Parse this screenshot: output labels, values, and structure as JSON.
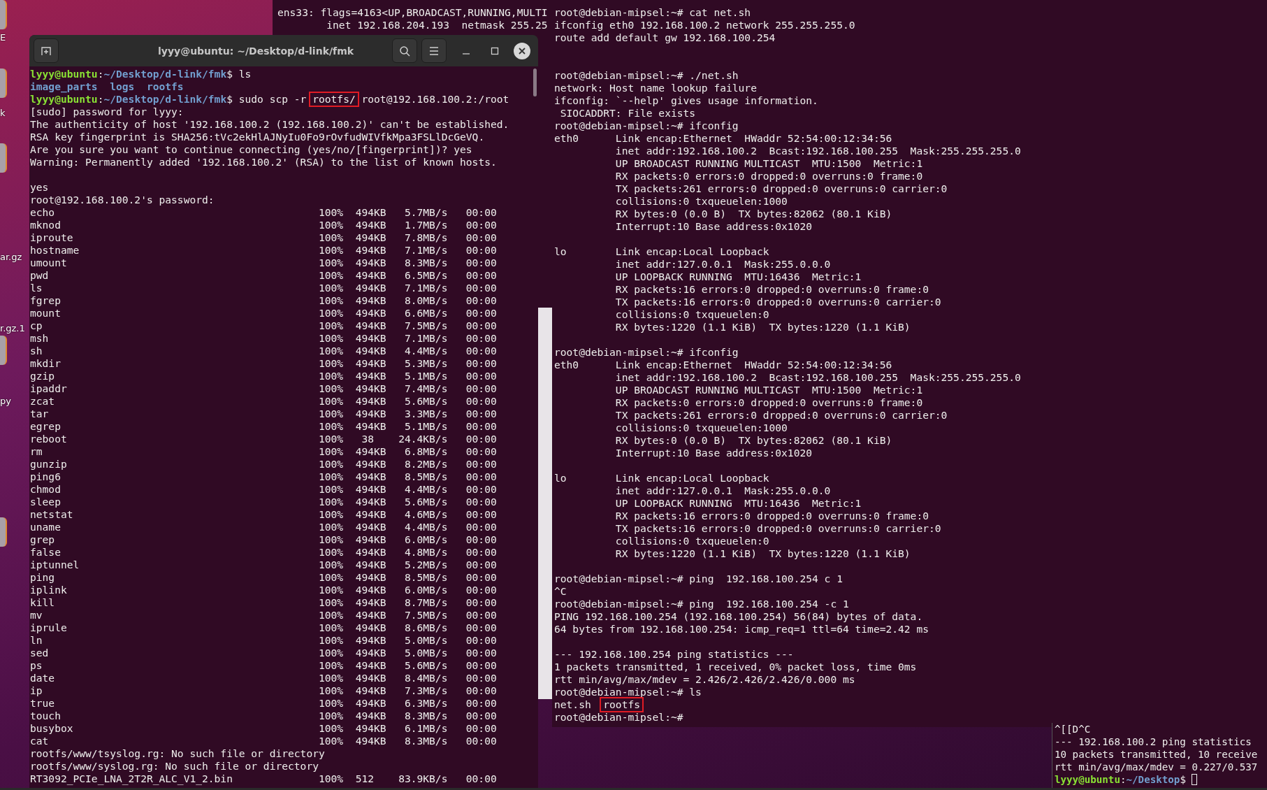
{
  "desktop_icons": [
    {
      "label": "E"
    },
    {
      "label": "k"
    },
    {
      "label": "ar.gz"
    },
    {
      "label": "r.gz.1"
    },
    {
      "label": "py"
    }
  ],
  "terminals": [
    {
      "kind": "back",
      "lines": [
        {
          "kind": "text",
          "text": "ens33: flags=4163<UP,BROADCAST,RUNNING,MULTI"
        },
        {
          "kind": "text",
          "text": "        inet 192.168.204.193  netmask 255.25"
        }
      ]
    },
    {
      "kind": "main",
      "title": "lyyy@ubuntu: ~/Desktop/d-link/fmk",
      "lines": [
        {
          "kind": "segments",
          "segments": [
            {
              "kind": "user",
              "text": "lyyy@ubuntu"
            },
            {
              "kind": "plain",
              "text": ":"
            },
            {
              "kind": "path",
              "text": "~/Desktop/d-link/fmk"
            },
            {
              "kind": "plain",
              "text": "$ ls"
            }
          ]
        },
        {
          "kind": "segments",
          "segments": [
            {
              "kind": "dir",
              "text": "image_parts  logs  rootfs"
            }
          ]
        },
        {
          "kind": "segments",
          "segments": [
            {
              "kind": "user",
              "text": "lyyy@ubuntu"
            },
            {
              "kind": "plain",
              "text": ":"
            },
            {
              "kind": "path",
              "text": "~/Desktop/d-link/fmk"
            },
            {
              "kind": "plain",
              "text": "$ sudo scp -r "
            },
            {
              "kind": "boxed",
              "text": "rootfs/"
            },
            {
              "kind": "plain",
              "text": " root@192.168.100.2:/root"
            }
          ]
        },
        {
          "kind": "text",
          "text": "[sudo] password for lyyy:"
        },
        {
          "kind": "text",
          "text": "The authenticity of host '192.168.100.2 (192.168.100.2)' can't be established."
        },
        {
          "kind": "text",
          "text": "RSA key fingerprint is SHA256:tVc2ekHlAJNyIu0Fo9rOvfudWIVfkMpa3FSLlDcGeVQ."
        },
        {
          "kind": "text",
          "text": "Are you sure you want to continue connecting (yes/no/[fingerprint])? yes"
        },
        {
          "kind": "text",
          "text": "Warning: Permanently added '192.168.100.2' (RSA) to the list of known hosts."
        },
        {
          "kind": "blank"
        },
        {
          "kind": "text",
          "text": "yes"
        },
        {
          "kind": "text",
          "text": "root@192.168.100.2's password:"
        },
        {
          "kind": "transfer",
          "file": "echo",
          "percent": "100%",
          "size": "494KB",
          "rate": "5.7MB/s",
          "time": "00:00"
        },
        {
          "kind": "transfer",
          "file": "mknod",
          "percent": "100%",
          "size": "494KB",
          "rate": "1.7MB/s",
          "time": "00:00"
        },
        {
          "kind": "transfer",
          "file": "iproute",
          "percent": "100%",
          "size": "494KB",
          "rate": "7.8MB/s",
          "time": "00:00"
        },
        {
          "kind": "transfer",
          "file": "hostname",
          "percent": "100%",
          "size": "494KB",
          "rate": "7.1MB/s",
          "time": "00:00"
        },
        {
          "kind": "transfer",
          "file": "umount",
          "percent": "100%",
          "size": "494KB",
          "rate": "8.3MB/s",
          "time": "00:00"
        },
        {
          "kind": "transfer",
          "file": "pwd",
          "percent": "100%",
          "size": "494KB",
          "rate": "6.5MB/s",
          "time": "00:00"
        },
        {
          "kind": "transfer",
          "file": "ls",
          "percent": "100%",
          "size": "494KB",
          "rate": "7.1MB/s",
          "time": "00:00"
        },
        {
          "kind": "transfer",
          "file": "fgrep",
          "percent": "100%",
          "size": "494KB",
          "rate": "8.0MB/s",
          "time": "00:00"
        },
        {
          "kind": "transfer",
          "file": "mount",
          "percent": "100%",
          "size": "494KB",
          "rate": "6.6MB/s",
          "time": "00:00"
        },
        {
          "kind": "transfer",
          "file": "cp",
          "percent": "100%",
          "size": "494KB",
          "rate": "7.5MB/s",
          "time": "00:00"
        },
        {
          "kind": "transfer",
          "file": "msh",
          "percent": "100%",
          "size": "494KB",
          "rate": "7.1MB/s",
          "time": "00:00"
        },
        {
          "kind": "transfer",
          "file": "sh",
          "percent": "100%",
          "size": "494KB",
          "rate": "4.4MB/s",
          "time": "00:00"
        },
        {
          "kind": "transfer",
          "file": "mkdir",
          "percent": "100%",
          "size": "494KB",
          "rate": "5.3MB/s",
          "time": "00:00"
        },
        {
          "kind": "transfer",
          "file": "gzip",
          "percent": "100%",
          "size": "494KB",
          "rate": "5.1MB/s",
          "time": "00:00"
        },
        {
          "kind": "transfer",
          "file": "ipaddr",
          "percent": "100%",
          "size": "494KB",
          "rate": "7.4MB/s",
          "time": "00:00"
        },
        {
          "kind": "transfer",
          "file": "zcat",
          "percent": "100%",
          "size": "494KB",
          "rate": "5.6MB/s",
          "time": "00:00"
        },
        {
          "kind": "transfer",
          "file": "tar",
          "percent": "100%",
          "size": "494KB",
          "rate": "3.3MB/s",
          "time": "00:00"
        },
        {
          "kind": "transfer",
          "file": "egrep",
          "percent": "100%",
          "size": "494KB",
          "rate": "5.1MB/s",
          "time": "00:00"
        },
        {
          "kind": "transfer",
          "file": "reboot",
          "percent": "100%",
          "size": " 38",
          "rate": "24.4KB/s",
          "time": "00:00"
        },
        {
          "kind": "transfer",
          "file": "rm",
          "percent": "100%",
          "size": "494KB",
          "rate": "6.8MB/s",
          "time": "00:00"
        },
        {
          "kind": "transfer",
          "file": "gunzip",
          "percent": "100%",
          "size": "494KB",
          "rate": "8.2MB/s",
          "time": "00:00"
        },
        {
          "kind": "transfer",
          "file": "ping6",
          "percent": "100%",
          "size": "494KB",
          "rate": "8.5MB/s",
          "time": "00:00"
        },
        {
          "kind": "transfer",
          "file": "chmod",
          "percent": "100%",
          "size": "494KB",
          "rate": "4.4MB/s",
          "time": "00:00"
        },
        {
          "kind": "transfer",
          "file": "sleep",
          "percent": "100%",
          "size": "494KB",
          "rate": "5.6MB/s",
          "time": "00:00"
        },
        {
          "kind": "transfer",
          "file": "netstat",
          "percent": "100%",
          "size": "494KB",
          "rate": "4.6MB/s",
          "time": "00:00"
        },
        {
          "kind": "transfer",
          "file": "uname",
          "percent": "100%",
          "size": "494KB",
          "rate": "4.4MB/s",
          "time": "00:00"
        },
        {
          "kind": "transfer",
          "file": "grep",
          "percent": "100%",
          "size": "494KB",
          "rate": "6.0MB/s",
          "time": "00:00"
        },
        {
          "kind": "transfer",
          "file": "false",
          "percent": "100%",
          "size": "494KB",
          "rate": "4.8MB/s",
          "time": "00:00"
        },
        {
          "kind": "transfer",
          "file": "iptunnel",
          "percent": "100%",
          "size": "494KB",
          "rate": "5.2MB/s",
          "time": "00:00"
        },
        {
          "kind": "transfer",
          "file": "ping",
          "percent": "100%",
          "size": "494KB",
          "rate": "8.5MB/s",
          "time": "00:00"
        },
        {
          "kind": "transfer",
          "file": "iplink",
          "percent": "100%",
          "size": "494KB",
          "rate": "6.0MB/s",
          "time": "00:00"
        },
        {
          "kind": "transfer",
          "file": "kill",
          "percent": "100%",
          "size": "494KB",
          "rate": "8.7MB/s",
          "time": "00:00"
        },
        {
          "kind": "transfer",
          "file": "mv",
          "percent": "100%",
          "size": "494KB",
          "rate": "7.5MB/s",
          "time": "00:00"
        },
        {
          "kind": "transfer",
          "file": "iprule",
          "percent": "100%",
          "size": "494KB",
          "rate": "8.6MB/s",
          "time": "00:00"
        },
        {
          "kind": "transfer",
          "file": "ln",
          "percent": "100%",
          "size": "494KB",
          "rate": "5.0MB/s",
          "time": "00:00"
        },
        {
          "kind": "transfer",
          "file": "sed",
          "percent": "100%",
          "size": "494KB",
          "rate": "5.0MB/s",
          "time": "00:00"
        },
        {
          "kind": "transfer",
          "file": "ps",
          "percent": "100%",
          "size": "494KB",
          "rate": "5.6MB/s",
          "time": "00:00"
        },
        {
          "kind": "transfer",
          "file": "date",
          "percent": "100%",
          "size": "494KB",
          "rate": "8.4MB/s",
          "time": "00:00"
        },
        {
          "kind": "transfer",
          "file": "ip",
          "percent": "100%",
          "size": "494KB",
          "rate": "7.3MB/s",
          "time": "00:00"
        },
        {
          "kind": "transfer",
          "file": "true",
          "percent": "100%",
          "size": "494KB",
          "rate": "6.3MB/s",
          "time": "00:00"
        },
        {
          "kind": "transfer",
          "file": "touch",
          "percent": "100%",
          "size": "494KB",
          "rate": "8.3MB/s",
          "time": "00:00"
        },
        {
          "kind": "transfer",
          "file": "busybox",
          "percent": "100%",
          "size": "494KB",
          "rate": "6.1MB/s",
          "time": "00:00"
        },
        {
          "kind": "transfer",
          "file": "cat",
          "percent": "100%",
          "size": "494KB",
          "rate": "8.3MB/s",
          "time": "00:00"
        },
        {
          "kind": "text",
          "text": "rootfs/www/tsyslog.rg: No such file or directory"
        },
        {
          "kind": "text",
          "text": "rootfs/www/syslog.rg: No such file or directory"
        },
        {
          "kind": "transfer",
          "file": "RT3092_PCIe_LNA_2T2R_ALC_V1_2.bin",
          "percent": "100%",
          "size": "512",
          "rate": "83.9KB/s",
          "time": "00:00"
        }
      ]
    },
    {
      "kind": "remote",
      "lines": [
        {
          "kind": "text",
          "text": "root@debian-mipsel:~# cat net.sh"
        },
        {
          "kind": "text",
          "text": "ifconfig eth0 192.168.100.2 network 255.255.255.0"
        },
        {
          "kind": "text",
          "text": "route add default gw 192.168.100.254"
        },
        {
          "kind": "blank"
        },
        {
          "kind": "blank"
        },
        {
          "kind": "text",
          "text": "root@debian-mipsel:~# ./net.sh"
        },
        {
          "kind": "text",
          "text": "network: Host name lookup failure"
        },
        {
          "kind": "text",
          "text": "ifconfig: `--help' gives usage information."
        },
        {
          "kind": "text",
          "text": " SIOCADDRT: File exists"
        },
        {
          "kind": "text",
          "text": "root@debian-mipsel:~# ifconfig"
        },
        {
          "kind": "text",
          "text": "eth0      Link encap:Ethernet  HWaddr 52:54:00:12:34:56"
        },
        {
          "kind": "text",
          "text": "          inet addr:192.168.100.2  Bcast:192.168.100.255  Mask:255.255.255.0"
        },
        {
          "kind": "text",
          "text": "          UP BROADCAST RUNNING MULTICAST  MTU:1500  Metric:1"
        },
        {
          "kind": "text",
          "text": "          RX packets:0 errors:0 dropped:0 overruns:0 frame:0"
        },
        {
          "kind": "text",
          "text": "          TX packets:261 errors:0 dropped:0 overruns:0 carrier:0"
        },
        {
          "kind": "text",
          "text": "          collisions:0 txqueuelen:1000"
        },
        {
          "kind": "text",
          "text": "          RX bytes:0 (0.0 B)  TX bytes:82062 (80.1 KiB)"
        },
        {
          "kind": "text",
          "text": "          Interrupt:10 Base address:0x1020"
        },
        {
          "kind": "blank"
        },
        {
          "kind": "text",
          "text": "lo        Link encap:Local Loopback"
        },
        {
          "kind": "text",
          "text": "          inet addr:127.0.0.1  Mask:255.0.0.0"
        },
        {
          "kind": "text",
          "text": "          UP LOOPBACK RUNNING  MTU:16436  Metric:1"
        },
        {
          "kind": "text",
          "text": "          RX packets:16 errors:0 dropped:0 overruns:0 frame:0"
        },
        {
          "kind": "text",
          "text": "          TX packets:16 errors:0 dropped:0 overruns:0 carrier:0"
        },
        {
          "kind": "text",
          "text": "          collisions:0 txqueuelen:0"
        },
        {
          "kind": "text",
          "text": "          RX bytes:1220 (1.1 KiB)  TX bytes:1220 (1.1 KiB)"
        },
        {
          "kind": "blank"
        },
        {
          "kind": "text",
          "text": "root@debian-mipsel:~# ifconfig"
        },
        {
          "kind": "text",
          "text": "eth0      Link encap:Ethernet  HWaddr 52:54:00:12:34:56"
        },
        {
          "kind": "text",
          "text": "          inet addr:192.168.100.2  Bcast:192.168.100.255  Mask:255.255.255.0"
        },
        {
          "kind": "text",
          "text": "          UP BROADCAST RUNNING MULTICAST  MTU:1500  Metric:1"
        },
        {
          "kind": "text",
          "text": "          RX packets:0 errors:0 dropped:0 overruns:0 frame:0"
        },
        {
          "kind": "text",
          "text": "          TX packets:261 errors:0 dropped:0 overruns:0 carrier:0"
        },
        {
          "kind": "text",
          "text": "          collisions:0 txqueuelen:1000"
        },
        {
          "kind": "text",
          "text": "          RX bytes:0 (0.0 B)  TX bytes:82062 (80.1 KiB)"
        },
        {
          "kind": "text",
          "text": "          Interrupt:10 Base address:0x1020"
        },
        {
          "kind": "blank"
        },
        {
          "kind": "text",
          "text": "lo        Link encap:Local Loopback"
        },
        {
          "kind": "text",
          "text": "          inet addr:127.0.0.1  Mask:255.0.0.0"
        },
        {
          "kind": "text",
          "text": "          UP LOOPBACK RUNNING  MTU:16436  Metric:1"
        },
        {
          "kind": "text",
          "text": "          RX packets:16 errors:0 dropped:0 overruns:0 frame:0"
        },
        {
          "kind": "text",
          "text": "          TX packets:16 errors:0 dropped:0 overruns:0 carrier:0"
        },
        {
          "kind": "text",
          "text": "          collisions:0 txqueuelen:0"
        },
        {
          "kind": "text",
          "text": "          RX bytes:1220 (1.1 KiB)  TX bytes:1220 (1.1 KiB)"
        },
        {
          "kind": "blank"
        },
        {
          "kind": "text",
          "text": "root@debian-mipsel:~# ping  192.168.100.254 c 1"
        },
        {
          "kind": "text",
          "text": "^C"
        },
        {
          "kind": "text",
          "text": "root@debian-mipsel:~# ping  192.168.100.254 -c 1"
        },
        {
          "kind": "text",
          "text": "PING 192.168.100.254 (192.168.100.254) 56(84) bytes of data."
        },
        {
          "kind": "text",
          "text": "64 bytes from 192.168.100.254: icmp_req=1 ttl=64 time=2.42 ms"
        },
        {
          "kind": "blank"
        },
        {
          "kind": "text",
          "text": "--- 192.168.100.254 ping statistics ---"
        },
        {
          "kind": "text",
          "text": "1 packets transmitted, 1 received, 0% packet loss, time 0ms"
        },
        {
          "kind": "text",
          "text": "rtt min/avg/max/mdev = 2.426/2.426/2.426/0.000 ms"
        },
        {
          "kind": "text",
          "text": "root@debian-mipsel:~# ls"
        },
        {
          "kind": "segments",
          "segments": [
            {
              "kind": "plain",
              "text": "net.sh  "
            },
            {
              "kind": "boxed",
              "text": "rootfs"
            }
          ]
        },
        {
          "kind": "text",
          "text": "root@debian-mipsel:~#"
        }
      ]
    },
    {
      "kind": "corner",
      "lines": [
        {
          "kind": "text",
          "text": "^[[D^C"
        },
        {
          "kind": "text",
          "text": "--- 192.168.100.2 ping statistics"
        },
        {
          "kind": "text",
          "text": "10 packets transmitted, 10 receive"
        },
        {
          "kind": "text",
          "text": "rtt min/avg/max/mdev = 0.227/0.537"
        },
        {
          "kind": "segments",
          "cursor": true,
          "segments": [
            {
              "kind": "user",
              "text": "lyyy@ubuntu"
            },
            {
              "kind": "plain",
              "text": ":"
            },
            {
              "kind": "path",
              "text": "~/Desktop"
            },
            {
              "kind": "plain",
              "text": "$ "
            }
          ]
        }
      ]
    }
  ]
}
